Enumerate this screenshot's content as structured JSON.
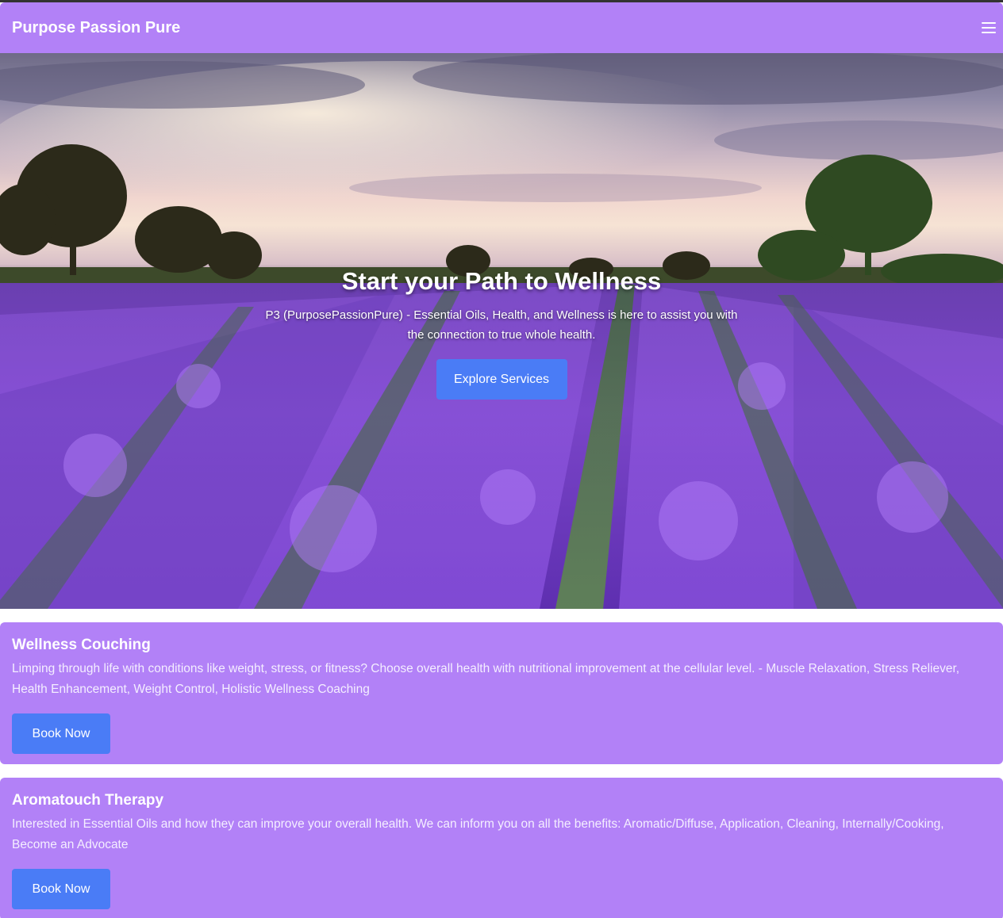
{
  "navbar": {
    "brand": "Purpose Passion Pure",
    "menu_icon": "hamburger-menu-icon"
  },
  "hero": {
    "title": "Start your Path to Wellness",
    "subtitle": "P3 (PurposePassionPure) - Essential Oils, Health, and Wellness is here to assist you with the connection to true whole health.",
    "button_label": "Explore Services",
    "background_image": "lavender field at sunset with trees on the horizon"
  },
  "services": [
    {
      "title": "Wellness Couching",
      "description": "Limping through life with conditions like weight, stress, or fitness? Choose overall health with nutritional improvement at the cellular level. - Muscle Relaxation, Stress Reliever, Health Enhancement, Weight Control, Holistic Wellness Coaching",
      "button_label": "Book Now"
    },
    {
      "title": "Aromatouch Therapy",
      "description": "Interested in Essential Oils and how they can improve your overall health. We can inform you on all the benefits: Aromatic/Diffuse, Application, Cleaning, Internally/Cooking, Become an Advocate",
      "button_label": "Book Now"
    }
  ],
  "colors": {
    "primary_purple": "#b281f7",
    "button_blue": "#4a7cf6",
    "text_white": "#ffffff"
  }
}
